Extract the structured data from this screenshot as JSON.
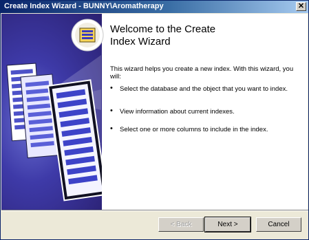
{
  "window": {
    "title": "Create Index Wizard - BUNNY\\Aromatherapy",
    "close_glyph": "✕"
  },
  "main": {
    "heading_line1": "Welcome to the Create",
    "heading_line2": "Index Wizard",
    "intro": "This wizard helps you create a new index. With this wizard, you will:",
    "bullets": [
      {
        "dot": "•",
        "text": "Select the database and the object that you want to index."
      },
      {
        "dot": "•",
        "text": "View information about current indexes."
      },
      {
        "dot": "•",
        "text": "Select one or more columns to include in the index."
      }
    ]
  },
  "buttons": {
    "back": "< Back",
    "next": "Next >",
    "cancel": "Cancel"
  },
  "colors": {
    "title_bar": "#0a246a",
    "banner": "#3e3aa8"
  },
  "icons": [
    "wizard-icon",
    "document-stack-graphic",
    "close-icon"
  ]
}
